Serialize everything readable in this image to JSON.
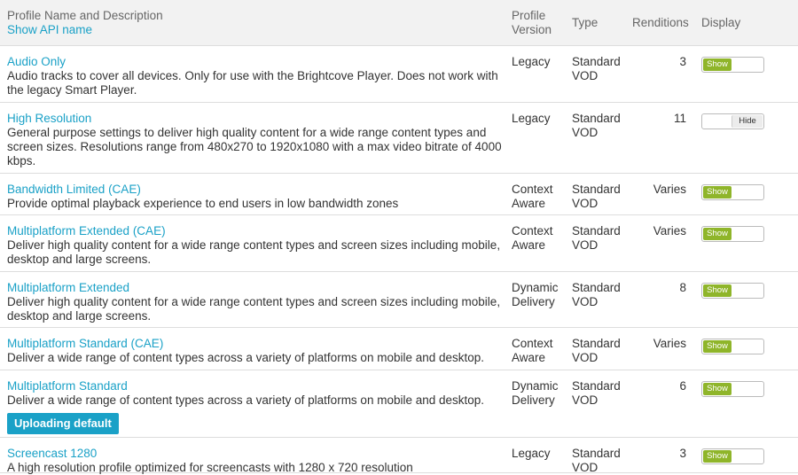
{
  "header": {
    "name_col": "Profile Name and Description",
    "show_api": "Show API name",
    "version_col": [
      "Profile",
      "Version"
    ],
    "type_col": "Type",
    "renditions_col": "Renditions",
    "display_col": "Display"
  },
  "rows": [
    {
      "name": "Audio Only",
      "desc": [
        "Audio tracks to cover all devices. Only for use with the Brightcove Player. Does not work with",
        "the legacy Smart Player."
      ],
      "version": [
        "Legacy"
      ],
      "type": [
        "Standard",
        "VOD"
      ],
      "renditions": "3",
      "display": "Show"
    },
    {
      "name": "High Resolution",
      "desc": [
        "General purpose settings to deliver high quality content for a wide range content types and",
        "screen sizes. Resolutions range from 480x270 to 1920x1080 with a max video bitrate of 4000",
        "kbps."
      ],
      "version": [
        "Legacy"
      ],
      "type": [
        "Standard",
        "VOD"
      ],
      "renditions": "11",
      "display": "Hide"
    },
    {
      "name": "Bandwidth Limited (CAE)",
      "desc": [
        "Provide optimal playback experience to end users in low bandwidth zones"
      ],
      "version": [
        "Context",
        "Aware"
      ],
      "type": [
        "Standard",
        "VOD"
      ],
      "renditions": "Varies",
      "display": "Show"
    },
    {
      "name": "Multiplatform Extended (CAE)",
      "desc": [
        "Deliver high quality content for a wide range content types and screen sizes including mobile,",
        "desktop and large screens."
      ],
      "version": [
        "Context",
        "Aware"
      ],
      "type": [
        "Standard",
        "VOD"
      ],
      "renditions": "Varies",
      "display": "Show"
    },
    {
      "name": "Multiplatform Extended",
      "desc": [
        "Deliver high quality content for a wide range content types and screen sizes including mobile,",
        "desktop and large screens."
      ],
      "version": [
        "Dynamic",
        "Delivery"
      ],
      "type": [
        "Standard",
        "VOD"
      ],
      "renditions": "8",
      "display": "Show"
    },
    {
      "name": "Multiplatform Standard (CAE)",
      "desc": [
        "Deliver a wide range of content types across a variety of platforms on mobile and desktop."
      ],
      "version": [
        "Context",
        "Aware"
      ],
      "type": [
        "Standard",
        "VOD"
      ],
      "renditions": "Varies",
      "display": "Show"
    },
    {
      "name": "Multiplatform Standard",
      "desc": [
        "Deliver a wide range of content types across a variety of platforms on mobile and desktop."
      ],
      "version": [
        "Dynamic",
        "Delivery"
      ],
      "type": [
        "Standard",
        "VOD"
      ],
      "renditions": "6",
      "display": "Show",
      "badge": "Uploading default"
    },
    {
      "name": "Screencast 1280",
      "desc": [
        "A high resolution profile optimized for screencasts with 1280 x 720 resolution"
      ],
      "version": [
        "Legacy"
      ],
      "type": [
        "Standard",
        "VOD"
      ],
      "renditions": "3",
      "display": "Show"
    }
  ],
  "colors": {
    "link": "#1aa1c7",
    "toggle_on": "#8fb52a",
    "header_bg": "#f2f2f2"
  }
}
